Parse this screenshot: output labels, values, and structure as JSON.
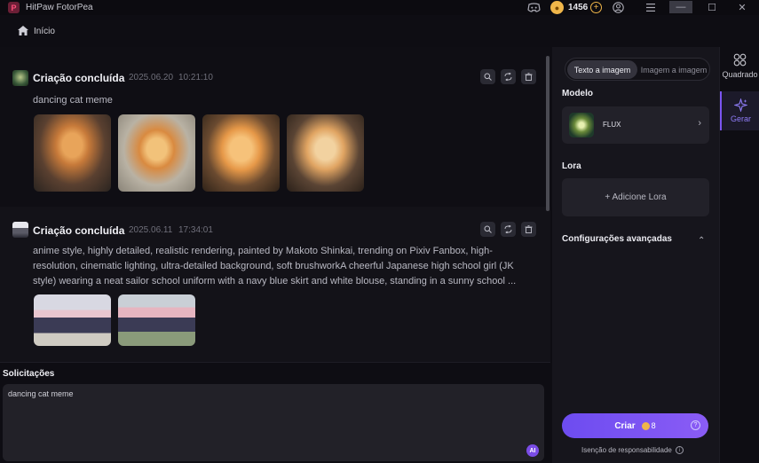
{
  "app": {
    "title": "HitPaw FotorPea",
    "logo_letter": "P"
  },
  "titlebar": {
    "coins": "1456",
    "add_coins": "+",
    "win_controls": [
      "—",
      "☐",
      "✕"
    ]
  },
  "breadcrumb": {
    "home_label": "Início"
  },
  "feed": {
    "cards": [
      {
        "status": "Criação concluída",
        "date": "2025.06.20",
        "time": "10:21:10",
        "prompt": "dancing cat meme",
        "image_count": 4
      },
      {
        "status": "Criação concluída",
        "date": "2025.06.11",
        "time": "17:34:01",
        "prompt": "anime style, highly detailed, realistic rendering, painted by Makoto Shinkai, trending on Pixiv Fanbox, high-resolution, cinematic lighting, ultra-detailed background, soft brushworkA cheerful Japanese high school girl (JK style) wearing a neat sailor school uniform with a navy blue skirt and white blouse, standing in a sunny school ...",
        "image_count": 2
      }
    ]
  },
  "prompt_panel": {
    "label": "Solicitações",
    "value": "dancing cat meme",
    "ai_badge": "AI"
  },
  "settings": {
    "tabs": [
      "Texto a imagem",
      "Imagem a imagem"
    ],
    "active_tab": "Texto a imagem",
    "model_label": "Modelo",
    "model_name": "FLUX",
    "model_chevron": "›",
    "lora_label": "Lora",
    "lora_button": "+ Adicione Lora",
    "advanced_label": "Configurações avançadas",
    "advanced_chevron": "⌃",
    "create_label": "Criar",
    "create_cost": "8",
    "create_help": "?",
    "disclaimer": "Isenção de responsabilidade",
    "info_glyph": "i"
  },
  "rail": {
    "items": [
      {
        "label": "Quadrado",
        "icon": "grid-icon"
      },
      {
        "label": "Gerar",
        "icon": "sparkle-icon"
      }
    ]
  },
  "colors": {
    "accent": "#7b55f2",
    "coin": "#f0b64a",
    "background": "#0e0d13"
  }
}
